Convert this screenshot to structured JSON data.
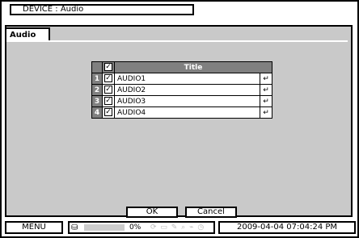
{
  "header": {
    "title": "DEVICE : Audio"
  },
  "tab": {
    "label": "Audio"
  },
  "table": {
    "title_header": "Title",
    "rows": [
      {
        "num": "1",
        "name": "AUDIO1"
      },
      {
        "num": "2",
        "name": "AUDIO2"
      },
      {
        "num": "3",
        "name": "AUDIO3"
      },
      {
        "num": "4",
        "name": "AUDIO4"
      }
    ],
    "enter_glyph": "↵",
    "check_glyph": "✓"
  },
  "buttons": {
    "ok": "OK",
    "cancel": "Cancel"
  },
  "statusbar": {
    "menu": "MENU",
    "disk_usage": "0%",
    "datetime": "2009-04-04 07:04:24 PM",
    "disk_icon": "⛁",
    "status_icons": "⟳ ▭ ✎ ⌕ ⌁ ◷"
  }
}
